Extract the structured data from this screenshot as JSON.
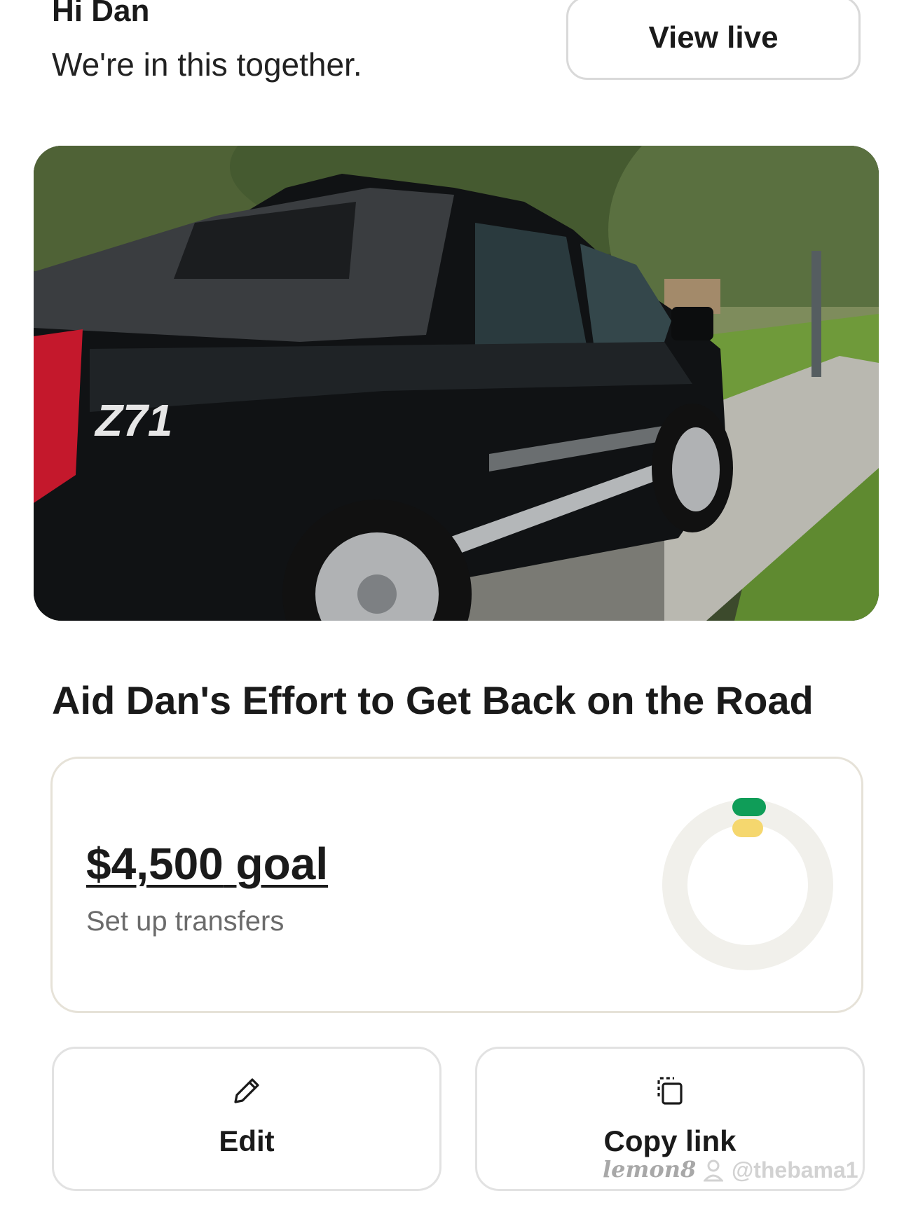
{
  "header": {
    "greeting": "Hi Dan",
    "subtitle": "We're in this together.",
    "view_live_label": "View live"
  },
  "hero": {
    "description": "",
    "badge_text": "Z71"
  },
  "campaign": {
    "title": "Aid Dan's Effort to Get Back on the Road"
  },
  "goal_card": {
    "goal_amount": "$4,500",
    "goal_suffix": "goal",
    "setup_transfers_label": "Set up transfers",
    "progress_fraction": 0,
    "colors": {
      "ring_track": "#f1f0eb",
      "indicator_primary": "#0f9d58",
      "indicator_secondary": "#f5d76e"
    }
  },
  "actions": {
    "edit_label": "Edit",
    "copy_link_label": "Copy link"
  },
  "watermark": {
    "logo": "lemon8",
    "user": "@thebama1"
  }
}
